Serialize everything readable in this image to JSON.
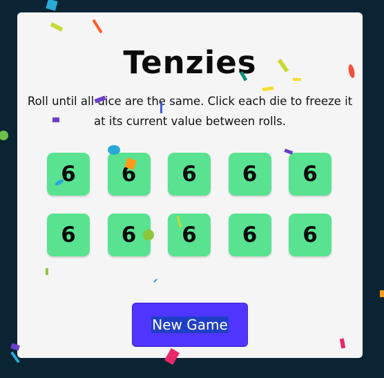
{
  "app": {
    "title": "Tenzies",
    "instructions": "Roll until all dice are the same. Click each die to freeze it at its current value between rolls."
  },
  "dice": [
    {
      "value": "6"
    },
    {
      "value": "6"
    },
    {
      "value": "6"
    },
    {
      "value": "6"
    },
    {
      "value": "6"
    },
    {
      "value": "6"
    },
    {
      "value": "6"
    },
    {
      "value": "6"
    },
    {
      "value": "6"
    },
    {
      "value": "6"
    }
  ],
  "actions": {
    "new_game_label": "New Game"
  },
  "colors": {
    "background": "#0b2434",
    "card": "#f5f5f5",
    "die_held": "#59e391",
    "button": "#5035ff"
  }
}
